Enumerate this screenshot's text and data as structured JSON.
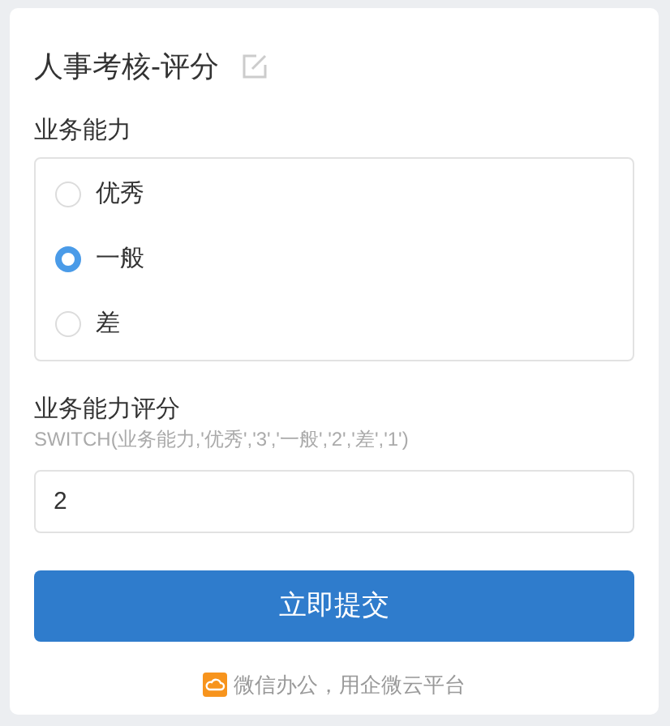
{
  "form": {
    "title": "人事考核-评分",
    "fields": [
      {
        "kind": "radio",
        "label": "业务能力",
        "options": [
          {
            "label": "优秀",
            "selected": false
          },
          {
            "label": "一般",
            "selected": true
          },
          {
            "label": "差",
            "selected": false
          }
        ]
      },
      {
        "kind": "text",
        "label": "业务能力评分",
        "hint": "SWITCH(业务能力,'优秀','3','一般','2','差','1')",
        "value": "2"
      }
    ],
    "submit": "立即提交",
    "footer": "微信办公，用企微云平台"
  }
}
